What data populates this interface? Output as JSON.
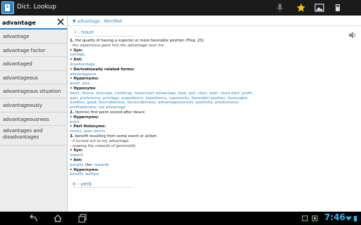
{
  "app": {
    "title": "Dict. Lookup"
  },
  "search": {
    "value": "advantage"
  },
  "words": [
    "advantage",
    "advantage factor",
    "advantaged",
    "advantageous",
    "advantageous situation",
    "advantageously",
    "advantageousness",
    "advantages and disadvantages"
  ],
  "entry": {
    "header": "▼ advantage - WordNet",
    "pos1": "I - noun",
    "s1_num": "1.",
    "s1_def": "the quality of having a superior or more favorable position (Freq. 23)",
    "s1_ex": "- the experience gave him the advantage over me",
    "syn": "• Syn:",
    "s1_syn": "vantage",
    "ant": "• Ant:",
    "s1_ant": "disadvantage",
    "deriv": "• Derivationally related forms:",
    "s1_deriv": "advantageous",
    "hyper": "• Hypernyms:",
    "s1_hyper": "asset, plus",
    "hypo": "• Hyponyms",
    "s1_hypo": "favor, favour, leverage, handicap, homecourt advantage, lead, pull, clout, start, head start, profit, gain, preference, privilege, expedience, expediency, superiority, favorable position, favourable position, good, favorableness, favourableness, advantageousness, positivity, positiveness, profitableness, tax advantage",
    "s2_num": "2.",
    "s2_def": "(tennis) first point scored after deuce",
    "hyper2": "• Hypernyms:",
    "s2_hyper": "point",
    "holo": "• Part Holonyms:",
    "s2_holo": "tennis, lawn tennis",
    "s3_num": "3.",
    "s3_def": "benefit resulting from some event or action",
    "s3_ex1": "- it turned out to my advantage",
    "s3_ex2": "- reaping the rewards of generosity",
    "syn3": "• Syn:",
    "s3_syn": "reward",
    "ant3": "• Ant:",
    "s3_ant_link": "penalty",
    "s3_ant_for": " (for: ",
    "s3_ant_for_link": "reward",
    "s3_ant_close": ")",
    "hyper3": "• Hypernyms:",
    "s3_hyper": "benefit, welfare",
    "pos2": "II - verb"
  },
  "status": {
    "clock": "7:46"
  },
  "icons": {
    "mic": "microphone-icon",
    "star": "star-icon",
    "image": "image-icon",
    "menu": "overflow-menu-icon",
    "clear": "close-icon",
    "speaker": "speaker-icon"
  },
  "colors": {
    "accent": "#2f86c6",
    "clock": "#33b5e5"
  }
}
